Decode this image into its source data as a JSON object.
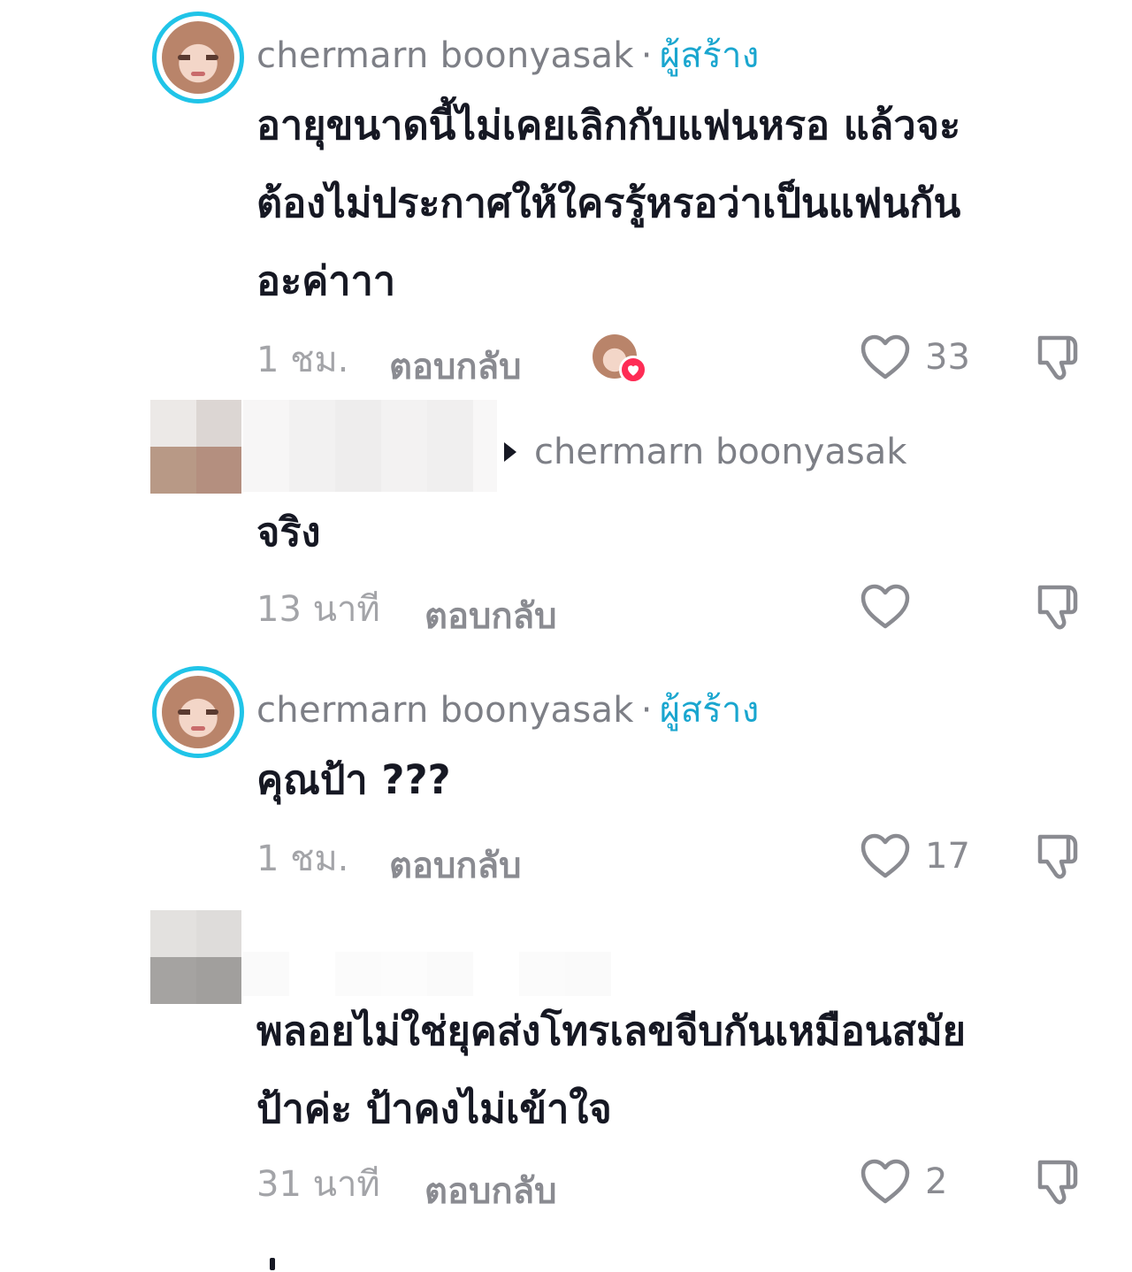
{
  "comments": [
    {
      "username": "chermarn boonyasak",
      "creator_label": "ผู้สร้าง",
      "text_lines": [
        "อายุขนาดนี้ไม่เคยเลิกกับแฟนหรอ แล้วจะ",
        "ต้องไม่ประกาศให้ใครรู้หรอว่าเป็นแฟนกัน",
        "อะค่าาา"
      ],
      "time": "1 ชม.",
      "reply_label": "ตอบกลับ",
      "likes": "33",
      "liked_by_creator": true
    },
    {
      "reply_to": "chermarn boonyasak",
      "text_lines": [
        "จริง"
      ],
      "time": "13 นาที",
      "reply_label": "ตอบกลับ",
      "likes": ""
    },
    {
      "username": "chermarn boonyasak",
      "creator_label": "ผู้สร้าง",
      "text_lines": [
        "คุณป้า ???"
      ],
      "time": "1 ชม.",
      "reply_label": "ตอบกลับ",
      "likes": "17"
    },
    {
      "text_lines": [
        "พลอยไม่ใช่ยุคส่งโทรเลขจีบกันเหมือนสมัย",
        "ป้าค่ะ ป้าคงไม่เข้าใจ"
      ],
      "time": "31 นาที",
      "reply_label": "ตอบกลับ",
      "likes": "2"
    }
  ],
  "icons": {
    "like": "heart-outline-icon",
    "dislike": "thumbs-down-icon",
    "reply_arrow": "triangle-right-icon"
  },
  "colors": {
    "creator_accent": "#1aa6cf",
    "avatar_ring": "#20c4e8",
    "heart_badge": "#fe2c55",
    "muted_text": "#8a8b91"
  }
}
